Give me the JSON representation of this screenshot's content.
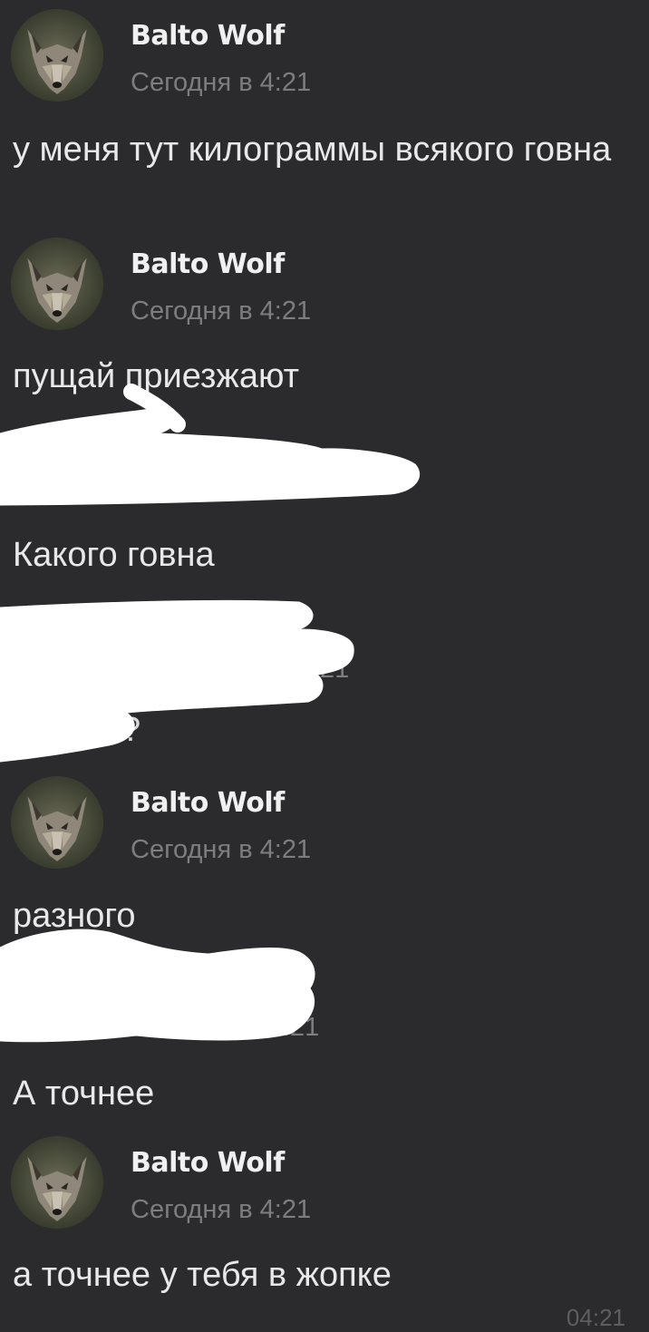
{
  "chat": {
    "messages": [
      {
        "author": "Balto Wolf",
        "time": "Сегодня в 4:21",
        "text": "у меня тут килограммы всякого говна"
      },
      {
        "author": "Balto Wolf",
        "time": "Сегодня в 4:21",
        "text": "пущай приезжают"
      },
      {
        "author": "",
        "time": "",
        "text": "Какого говна"
      },
      {
        "author": "",
        "time": "",
        "text": ""
      },
      {
        "author": "Balto Wolf",
        "time": "Сегодня в 4:21",
        "text": "разного"
      },
      {
        "author": "",
        "time": "",
        "text": "А точнее"
      },
      {
        "author": "Balto Wolf",
        "time": "Сегодня в 4:21",
        "text": "а точнее у тебя в жопке"
      }
    ],
    "partial": {
      "ghost_time_1": ":21",
      "ghost_time_2": ".21",
      "ghost_q": "?"
    },
    "last_timestamp": "04:21"
  },
  "icons": {
    "avatar": "wolf-avatar-icon"
  },
  "colors": {
    "background": "#2b2b2d",
    "text": "#e8e8e8",
    "muted": "#7d7d80",
    "redaction": "#ffffff"
  }
}
